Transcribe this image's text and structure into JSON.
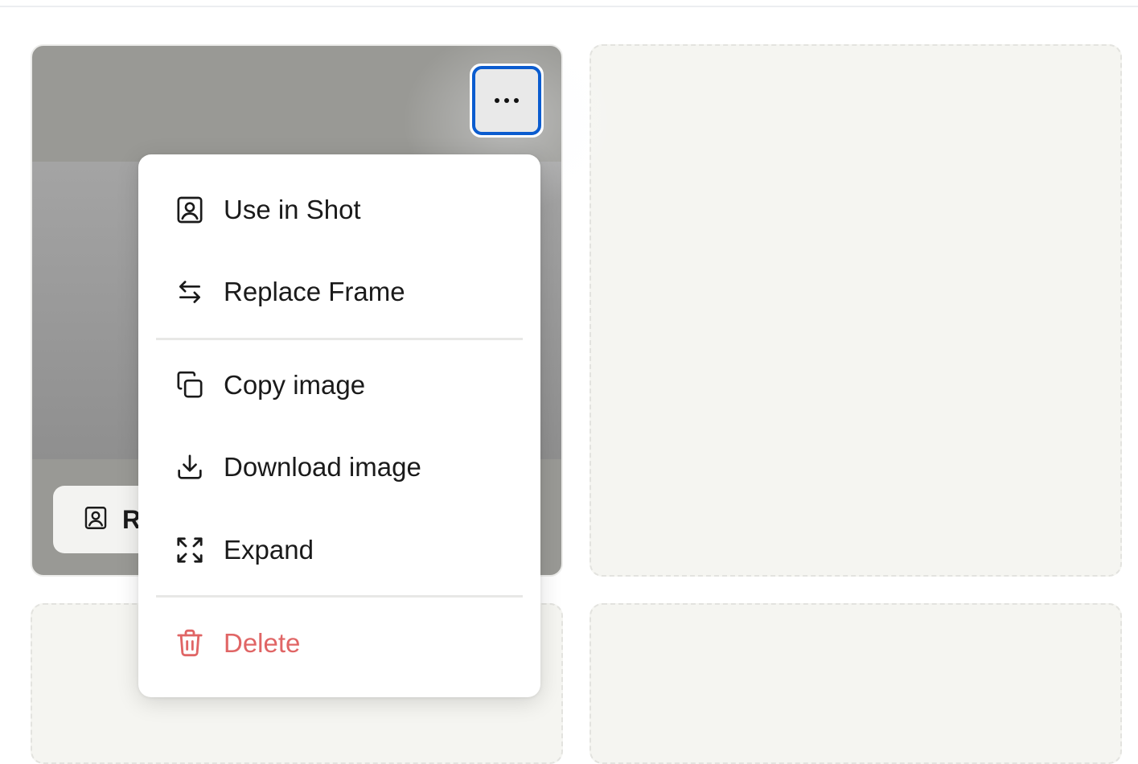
{
  "card": {
    "action_chip_label": "R",
    "action_chip_icon": "portrait-frame-icon",
    "more_button_icon": "more-horizontal-icon"
  },
  "context_menu": {
    "items": [
      {
        "label": "Use in Shot",
        "icon": "portrait-frame-icon"
      },
      {
        "label": "Replace Frame",
        "icon": "swap-arrows-icon"
      },
      {
        "label": "Copy image",
        "icon": "copy-icon"
      },
      {
        "label": "Download image",
        "icon": "download-icon"
      },
      {
        "label": "Expand",
        "icon": "expand-icon"
      },
      {
        "label": "Delete",
        "icon": "trash-icon",
        "color": "#e06565"
      }
    ]
  },
  "colors": {
    "focus_ring": "#0b5ccf",
    "danger": "#e06565",
    "empty_card": "#f5f5f1"
  }
}
